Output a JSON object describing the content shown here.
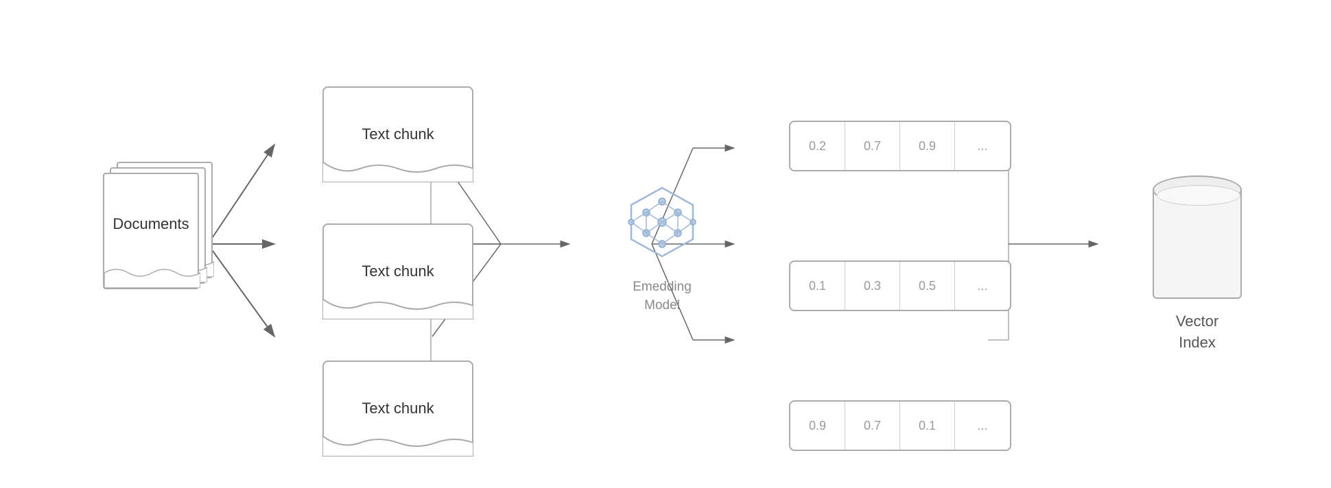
{
  "diagram": {
    "documents": {
      "label": "Documents"
    },
    "chunks": [
      {
        "label": "Text chunk"
      },
      {
        "label": "Text chunk"
      },
      {
        "label": "Text chunk"
      }
    ],
    "embedding": {
      "label": "Emedding\nModel"
    },
    "vectors": [
      {
        "values": [
          "0.2",
          "0.7",
          "0.9",
          "..."
        ]
      },
      {
        "values": [
          "0.1",
          "0.3",
          "0.5",
          "..."
        ]
      },
      {
        "values": [
          "0.9",
          "0.7",
          "0.1",
          "..."
        ]
      }
    ],
    "vectorIndex": {
      "label": "Vector\nIndex"
    }
  }
}
